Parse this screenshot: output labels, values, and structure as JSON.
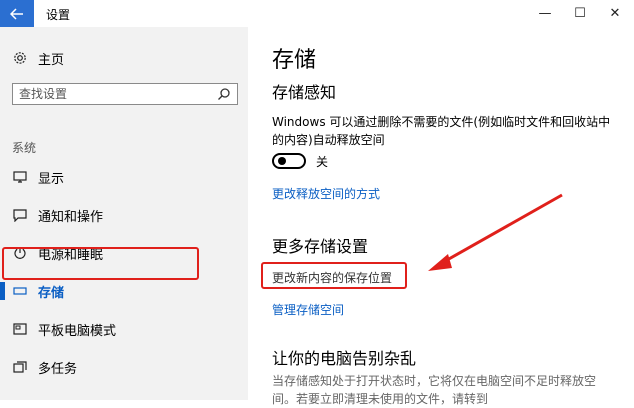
{
  "window": {
    "title": "设置",
    "back_icon": "back-arrow-icon",
    "min_glyph": "—",
    "max_glyph": "☐",
    "close_glyph": "✕"
  },
  "sidebar": {
    "home_label": "主页",
    "search_placeholder": "查找设置",
    "section_label": "系统",
    "items": [
      {
        "label": "显示",
        "icon": "monitor-icon"
      },
      {
        "label": "通知和操作",
        "icon": "notification-icon"
      },
      {
        "label": "电源和睡眠",
        "icon": "power-icon"
      },
      {
        "label": "存储",
        "icon": "storage-icon",
        "selected": true
      },
      {
        "label": "平板电脑模式",
        "icon": "tablet-icon"
      },
      {
        "label": "多任务",
        "icon": "multitask-icon"
      }
    ]
  },
  "main": {
    "title": "存储",
    "sense_heading": "存储感知",
    "sense_desc": "Windows 可以通过删除不需要的文件(例如临时文件和回收站中的内容)自动释放空间",
    "toggle_label": "关",
    "change_free_link": "更改释放空间的方式",
    "more_heading": "更多存储设置",
    "change_save_link": "更改新内容的保存位置",
    "manage_link": "管理存储空间",
    "clean_heading": "让你的电脑告别杂乱",
    "clean_desc": "当存储感知处于打开状态时，它将仅在电脑空间不足时释放空间。若要立即清理未使用的文件，请转到",
    "colors": {
      "accent": "#0b5fc4",
      "highlight": "#e0201b"
    }
  }
}
